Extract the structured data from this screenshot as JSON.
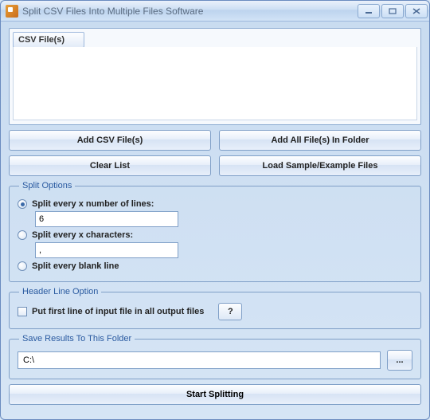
{
  "window": {
    "title": "Split CSV Files Into Multiple Files Software"
  },
  "filelist": {
    "header": "CSV File(s)"
  },
  "buttons": {
    "add_files": "Add CSV File(s)",
    "add_folder": "Add All File(s) In Folder",
    "clear_list": "Clear List",
    "load_sample": "Load Sample/Example Files",
    "browse": "...",
    "help": "?",
    "start": "Start Splitting"
  },
  "split_options": {
    "legend": "Split Options",
    "opt_lines": "Split every x number of lines:",
    "lines_value": "6",
    "opt_chars": "Split every x characters:",
    "chars_value": ",",
    "opt_blank": "Split every blank line",
    "selected": "lines"
  },
  "header_option": {
    "legend": "Header Line Option",
    "label": "Put first line of input file in all output files",
    "checked": false
  },
  "save_folder": {
    "legend": "Save Results To This Folder",
    "path": "C:\\"
  }
}
